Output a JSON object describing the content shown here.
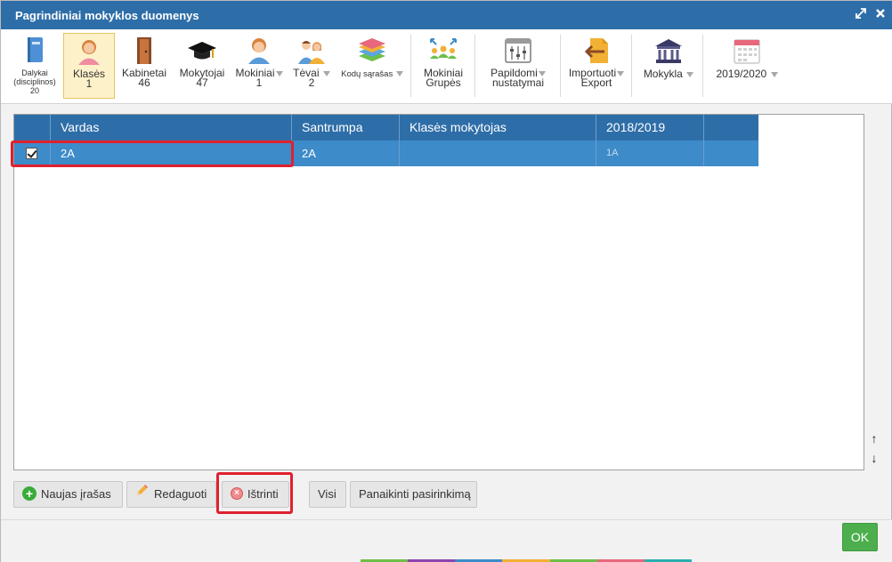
{
  "window": {
    "title": "Pagrindiniai mokyklos duomenys",
    "colors": {
      "titlebar": "#2e6ea8",
      "selected_row": "#3d8bc9",
      "highlight": "#e0202e",
      "ok": "#4cae4c"
    }
  },
  "toolbar": {
    "dalykai": {
      "line1": "Dalykai",
      "line2": "(disciplinos)",
      "count": "20",
      "icon": "book-icon"
    },
    "klases": {
      "label": "Klasės",
      "count": "1",
      "icon": "student-girl-icon"
    },
    "kabinetai": {
      "label": "Kabinetai",
      "count": "46",
      "icon": "door-icon"
    },
    "mokytojai": {
      "label": "Mokytojai",
      "count": "47",
      "icon": "graduation-cap-icon"
    },
    "mokiniai": {
      "label": "Mokiniai",
      "count": "1",
      "icon": "student-icon"
    },
    "tevai": {
      "label": "Tėvai",
      "count": "2",
      "icon": "parents-icon"
    },
    "kodu_sarasas": {
      "label": "Kodų sąrašas",
      "icon": "layers-icon"
    },
    "mokiniai_grupes": {
      "line1": "Mokiniai",
      "line2": "Grupės",
      "icon": "group-icon"
    },
    "papildomi": {
      "line1": "Papildomi",
      "line2": "nustatymai",
      "icon": "sliders-icon"
    },
    "importuoti": {
      "line1": "Importuoti",
      "line2": "Export",
      "icon": "import-icon"
    },
    "mokykla": {
      "label": "Mokykla",
      "icon": "school-building-icon"
    },
    "metai": {
      "label": "2019/2020",
      "icon": "calendar-icon"
    }
  },
  "grid": {
    "columns": [
      "Vardas",
      "Santrumpa",
      "Klasės mokytojas",
      "2018/2019"
    ],
    "rows": [
      {
        "vardas": "2A",
        "santrumpa": "2A",
        "mokytojas": "",
        "ankstesni": "1A",
        "checked": true
      }
    ]
  },
  "actions": {
    "naujas": "Naujas įrašas",
    "redaguoti": "Redaguoti",
    "istrinti": "Ištrinti",
    "visi": "Visi",
    "panaikinti": "Panaikinti pasirinkimą"
  },
  "footer": {
    "ok": "OK"
  },
  "scroll": {
    "up": "↑",
    "down": "↓"
  }
}
